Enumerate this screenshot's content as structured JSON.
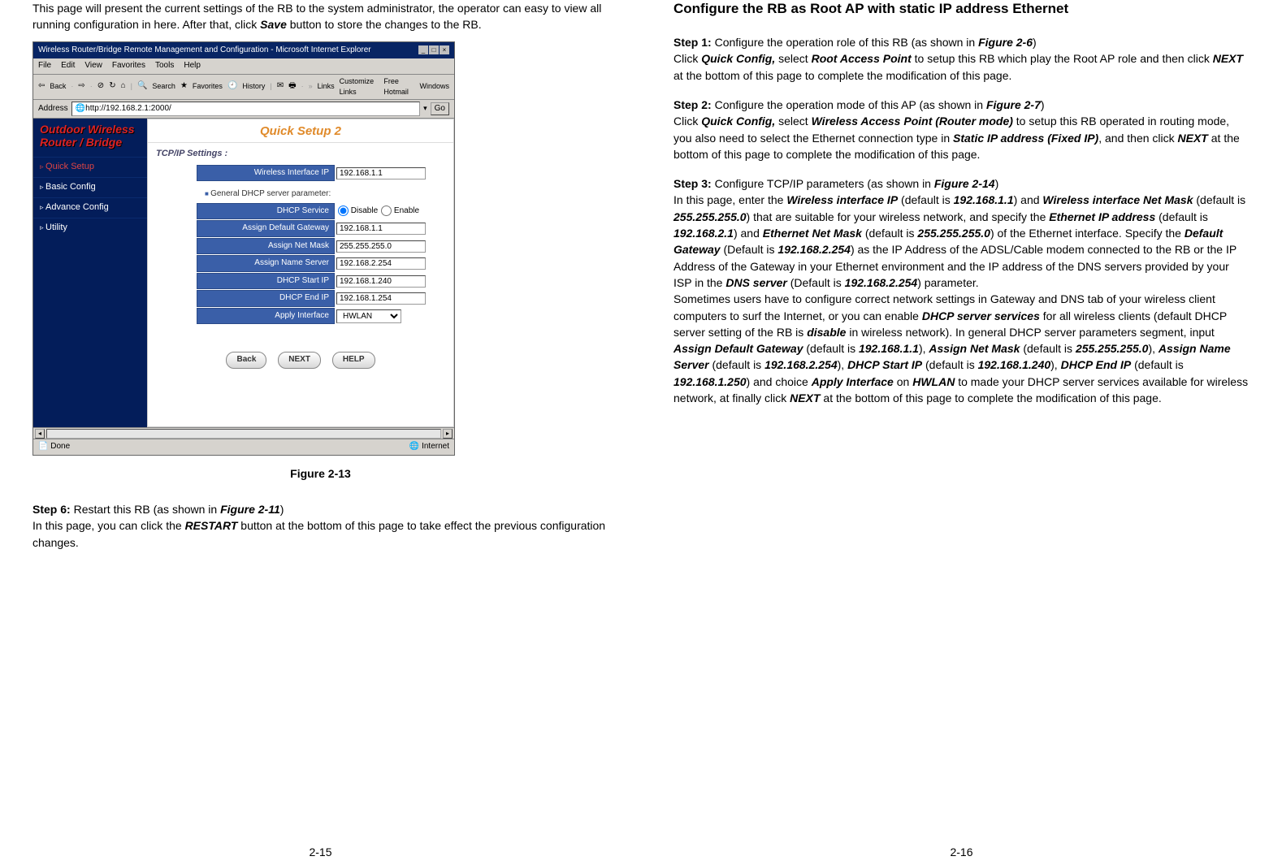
{
  "left": {
    "intro_pre": "This page will present the current settings of the RB to the system administrator, the operator can easy to view all running configuration in here. After that, click ",
    "intro_save": "Save",
    "intro_post": " button to store the changes to the RB.",
    "figure_caption": "Figure 2-13",
    "step6_label": "Step 6:",
    "step6_text1": " Restart this RB (as shown in ",
    "step6_ref": "Figure 2-11",
    "step6_text2": ")",
    "step6_body_pre": "In this page, you can click the ",
    "step6_restart": "RESTART",
    "step6_body_post": " button at the bottom of this page to take effect the previous configuration changes.",
    "page_num": "2-15"
  },
  "shot": {
    "title": "Wireless Router/Bridge Remote Management and Configuration - Microsoft Internet Explorer",
    "menus": [
      "File",
      "Edit",
      "View",
      "Favorites",
      "Tools",
      "Help"
    ],
    "toolbar": {
      "back": "Back",
      "search": "Search",
      "favorites": "Favorites",
      "history": "History",
      "links": "Links",
      "custom": "Customize Links",
      "hotmail": "Free Hotmail",
      "windows": "Windows"
    },
    "address_label": "Address",
    "address_value": "http://192.168.2.1:2000/",
    "go": "Go",
    "brand_line1": "Outdoor Wireless",
    "brand_line2": "Router / Bridge",
    "nav": [
      "Quick Setup",
      "Basic Config",
      "Advance Config",
      "Utility"
    ],
    "panel_title": "Quick Setup 2",
    "tcpip_label": "TCP/IP Settings :",
    "wif_label": "Wireless Interface IP",
    "wif_value": "192.168.1.1",
    "dhcp_section": "General DHCP server parameter:",
    "dhcp_service_label": "DHCP Service",
    "disable": "Disable",
    "enable": "Enable",
    "assign_gw_label": "Assign Default Gateway",
    "assign_gw_value": "192.168.1.1",
    "assign_nm_label": "Assign Net Mask",
    "assign_nm_value": "255.255.255.0",
    "assign_ns_label": "Assign Name Server",
    "assign_ns_value": "192.168.2.254",
    "dhcp_start_label": "DHCP Start IP",
    "dhcp_start_value": "192.168.1.240",
    "dhcp_end_label": "DHCP End IP",
    "dhcp_end_value": "192.168.1.254",
    "apply_if_label": "Apply Interface",
    "apply_if_value": "HWLAN",
    "btn_back": "Back",
    "btn_next": "NEXT",
    "btn_help": "HELP",
    "status_done": "Done",
    "status_zone": "Internet"
  },
  "right": {
    "heading": "Configure the RB as Root AP with static IP address Ethernet",
    "s1_label": "Step 1:",
    "s1_title_pre": " Configure the operation role of this RB (as shown in ",
    "s1_title_ref": "Figure 2-6",
    "s1_title_post": ")",
    "s1_b1": "Click ",
    "s1_qc": "Quick Config,",
    "s1_b2": " select ",
    "s1_rap": "Root Access Point",
    "s1_b3": " to setup this RB which play the Root AP role and then click ",
    "s1_next": "NEXT",
    "s1_b4": " at the bottom of this page to complete the modification of this page.",
    "s2_label": "Step 2:",
    "s2_title_pre": " Configure the operation mode of this AP (as shown in ",
    "s2_title_ref": "Figure 2-7",
    "s2_title_post": ")",
    "s2_b1": "Click ",
    "s2_qc": "Quick Config,",
    "s2_b2": " select ",
    "s2_wap": "Wireless Access Point (Router mode)",
    "s2_b3": " to setup this RB operated in routing mode, you also need to select the Ethernet connection type in ",
    "s2_static": "Static IP address (Fixed IP)",
    "s2_b4": ", and then click ",
    "s2_next": "NEXT",
    "s2_b5": " at the bottom of this page to complete the modification of this page.",
    "s3_label": "Step 3:",
    "s3_title_pre": " Configure TCP/IP parameters (as shown in ",
    "s3_title_ref": "Figure 2-14",
    "s3_title_post": ")",
    "s3_p1_a": "In this page, enter the ",
    "s3_wif": "Wireless interface IP",
    "s3_p1_b": " (default is ",
    "s3_wif_v": "192.168.1.1",
    "s3_p1_c": ") and ",
    "s3_wnm": "Wireless interface Net Mask",
    "s3_p1_d": " (default is ",
    "s3_wnm_v": "255.255.255.0",
    "s3_p1_e": ") that are suitable for your wireless network, and specify the ",
    "s3_eip": "Ethernet IP address",
    "s3_p1_f": " (default is ",
    "s3_eip_v": "192.168.2.1",
    "s3_p1_g": ") and ",
    "s3_enm": "Ethernet Net Mask",
    "s3_p1_h": " (default is ",
    "s3_enm_v": "255.255.255.0",
    "s3_p1_i": ") of the Ethernet interface. Specify the ",
    "s3_dgw": "Default Gateway",
    "s3_p1_j": " (Default is ",
    "s3_dgw_v": "192.168.2.254",
    "s3_p1_k": ") as the IP Address of the ADSL/Cable modem connected to the RB or the IP Address of the Gateway in your Ethernet environment and the IP address of the DNS servers provided by your ISP in the ",
    "s3_dns": "DNS server",
    "s3_p1_l": " (Default is ",
    "s3_dns_v": "192.168.2.254",
    "s3_p1_m": ") parameter.",
    "s3_p2_a": "Sometimes users have to configure correct network settings in Gateway and DNS tab of your wireless client computers to surf the Internet, or you can enable ",
    "s3_dhcps": "DHCP server services",
    "s3_p2_b": " for all wireless clients (default DHCP server setting of the RB is ",
    "s3_disable": "disable",
    "s3_p2_c": " in wireless network). In general DHCP server parameters segment, input ",
    "s3_adg": "Assign Default Gateway",
    "s3_p2_d": " (default is ",
    "s3_adg_v": "192.168.1.1",
    "s3_p2_e": "), ",
    "s3_anm": "Assign Net Mask",
    "s3_p2_f": " (default is ",
    "s3_anm_v": "255.255.255.0",
    "s3_p2_g": "), ",
    "s3_ans": "Assign Name Server",
    "s3_p2_h": " (default is ",
    "s3_ans_v": "192.168.2.254",
    "s3_p2_i": "), ",
    "s3_dsi": "DHCP Start IP",
    "s3_p2_j": " (default is ",
    "s3_dsi_v": "192.168.1.240",
    "s3_p2_k": "), ",
    "s3_dei": "DHCP End IP",
    "s3_p2_l": " (default is ",
    "s3_dei_v": "192.168.1.250",
    "s3_p2_m": ") and choice ",
    "s3_aif": "Apply Interface",
    "s3_p2_n": " on ",
    "s3_hwlan": "HWLAN",
    "s3_p2_o": " to made your DHCP server services available for wireless network, at finally click ",
    "s3_next": "NEXT",
    "s3_p2_p": " at the bottom of this page to complete the modification of this page.",
    "page_num": "2-16"
  }
}
